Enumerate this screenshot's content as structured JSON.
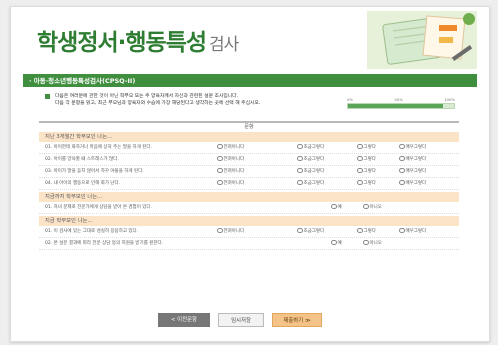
{
  "header": {
    "title": "학생정서·행동특성",
    "subtitle": "검사"
  },
  "section_bar": {
    "title": "· 아동·청소년행동특성검사(CPSQ-II)"
  },
  "instructions": {
    "line1": "다음은 여러분에 관한 것이 아닌 학부모 또는 주 양육자께서 자신과 관련된 설문 조사입니다.",
    "line2": "다음 각 문항을 읽고, 최근 부모님과 양육자와 수습에 가장 해당된다고 생각하는 곳에 선택 해 주십시오."
  },
  "progress": {
    "labels": [
      "0%",
      "50%",
      "100%"
    ],
    "value_percent": 90
  },
  "table": {
    "header": "문항"
  },
  "sections": [
    {
      "title": "지난 3개월간 학부모인 나는..."
    },
    {
      "title": "지금까지 학부모인 나는..."
    },
    {
      "title": "지금 학부모인 나는..."
    }
  ],
  "options4": [
    "전혀아니다",
    "조금그렇다",
    "그렇다",
    "매우그렇다"
  ],
  "options2": [
    "예",
    "아니오"
  ],
  "questions": [
    {
      "text": "01. 아이한테 화하거나 마음에 상처 주는 말을 하게 된다.",
      "type": 4
    },
    {
      "text": "02. 아이를 양육할 때 스트레스가 많다.",
      "type": 4
    },
    {
      "text": "03. 아이가 말을 듣지 않아서 자꾸 야물을 하게 된다.",
      "type": 4
    },
    {
      "text": "04. 내 아이의 행동으로 인해 화가 난다.",
      "type": 4
    },
    {
      "text": "01. 자녀 문제로 전문가에게 상담을 받아 본 경험이 있다.",
      "type": 2
    },
    {
      "text": "01. 이 검사에 있는 그대로 성실히 응답하고 있다.",
      "type": 4
    },
    {
      "text": "02. 본 설문 결과에 따라 전문 상담 등의 지원을 받기를 원한다.",
      "type": 2
    }
  ],
  "buttons": {
    "prev": "< 이전문항",
    "save": "임시저장",
    "submit": "제출하기 ≫"
  }
}
